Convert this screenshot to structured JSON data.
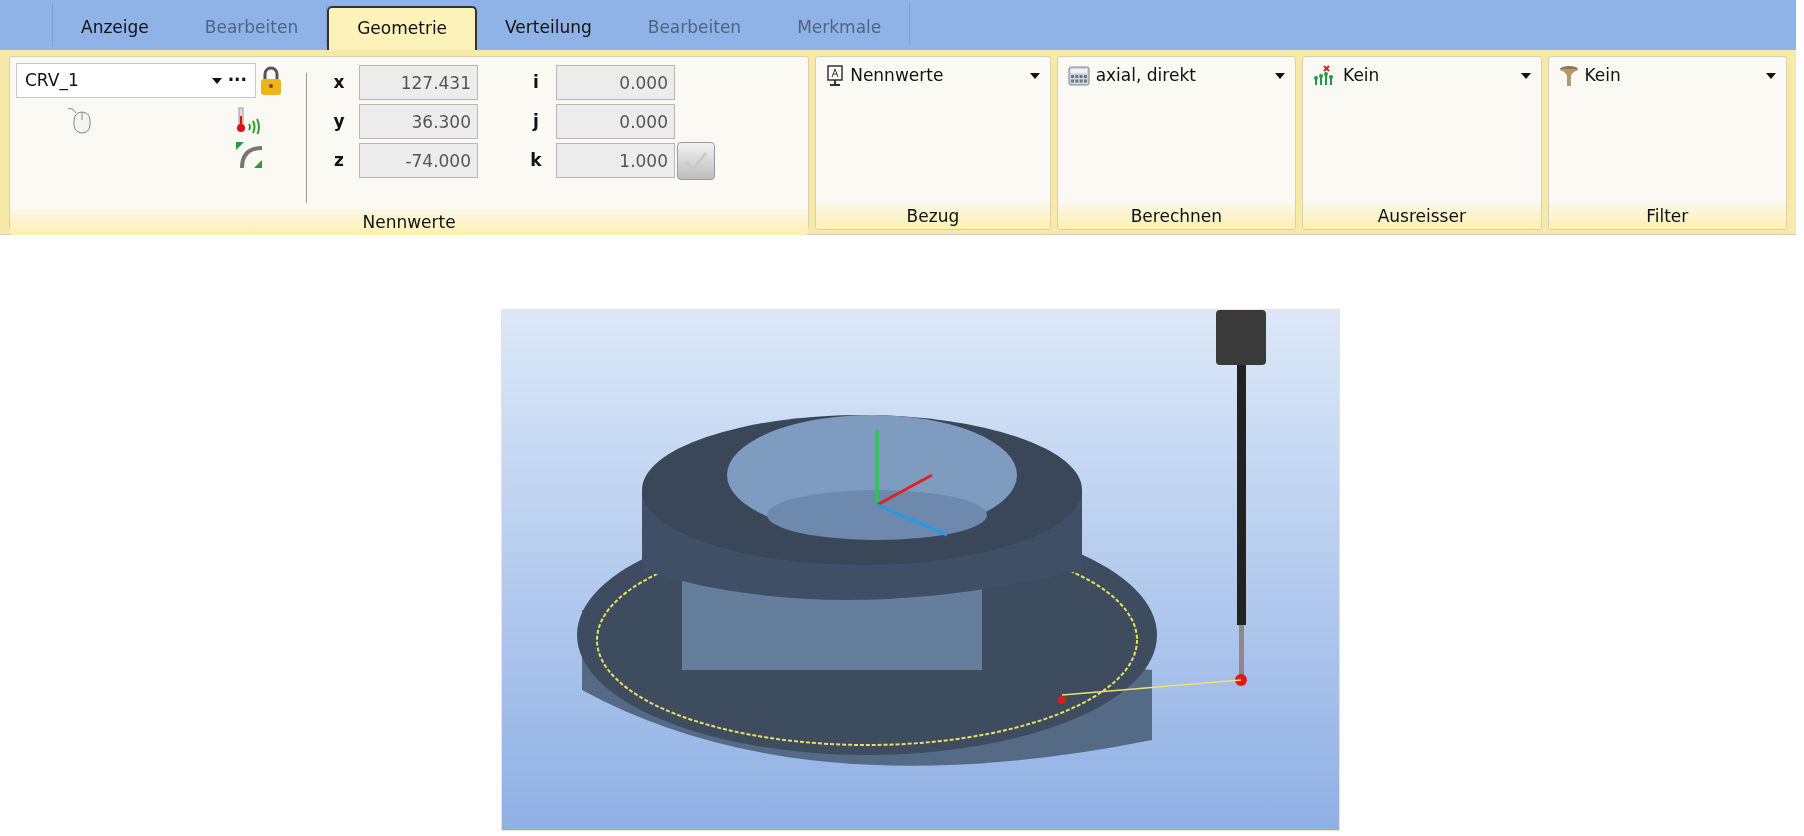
{
  "tabs": [
    {
      "label": "Anzeige",
      "selected": false,
      "disabled": false
    },
    {
      "label": "Bearbeiten",
      "selected": false,
      "disabled": true
    },
    {
      "label": "Geometrie",
      "selected": true,
      "disabled": false
    },
    {
      "label": "Verteilung",
      "selected": false,
      "disabled": false
    },
    {
      "label": "Bearbeiten",
      "selected": false,
      "disabled": true
    },
    {
      "label": "Merkmale",
      "selected": false,
      "disabled": true
    }
  ],
  "nennwerte": {
    "title": "Nennwerte",
    "element": "CRV_1",
    "menu_button": "···",
    "locked": true,
    "position": [
      {
        "axis": "x",
        "value": "127.431"
      },
      {
        "axis": "y",
        "value": "36.300"
      },
      {
        "axis": "z",
        "value": "-74.000"
      }
    ],
    "vector": [
      {
        "axis": "i",
        "value": "0.000"
      },
      {
        "axis": "j",
        "value": "0.000"
      },
      {
        "axis": "k",
        "value": "1.000"
      }
    ]
  },
  "groups": [
    {
      "title": "Bezug",
      "value": "Nennwerte",
      "kind": "nominal"
    },
    {
      "title": "Berechnen",
      "value": "axial, direkt",
      "kind": "calculator"
    },
    {
      "title": "Ausreisser",
      "value": "Kein",
      "kind": "outlier"
    },
    {
      "title": "Filter",
      "value": "Kein",
      "kind": "filter"
    }
  ]
}
